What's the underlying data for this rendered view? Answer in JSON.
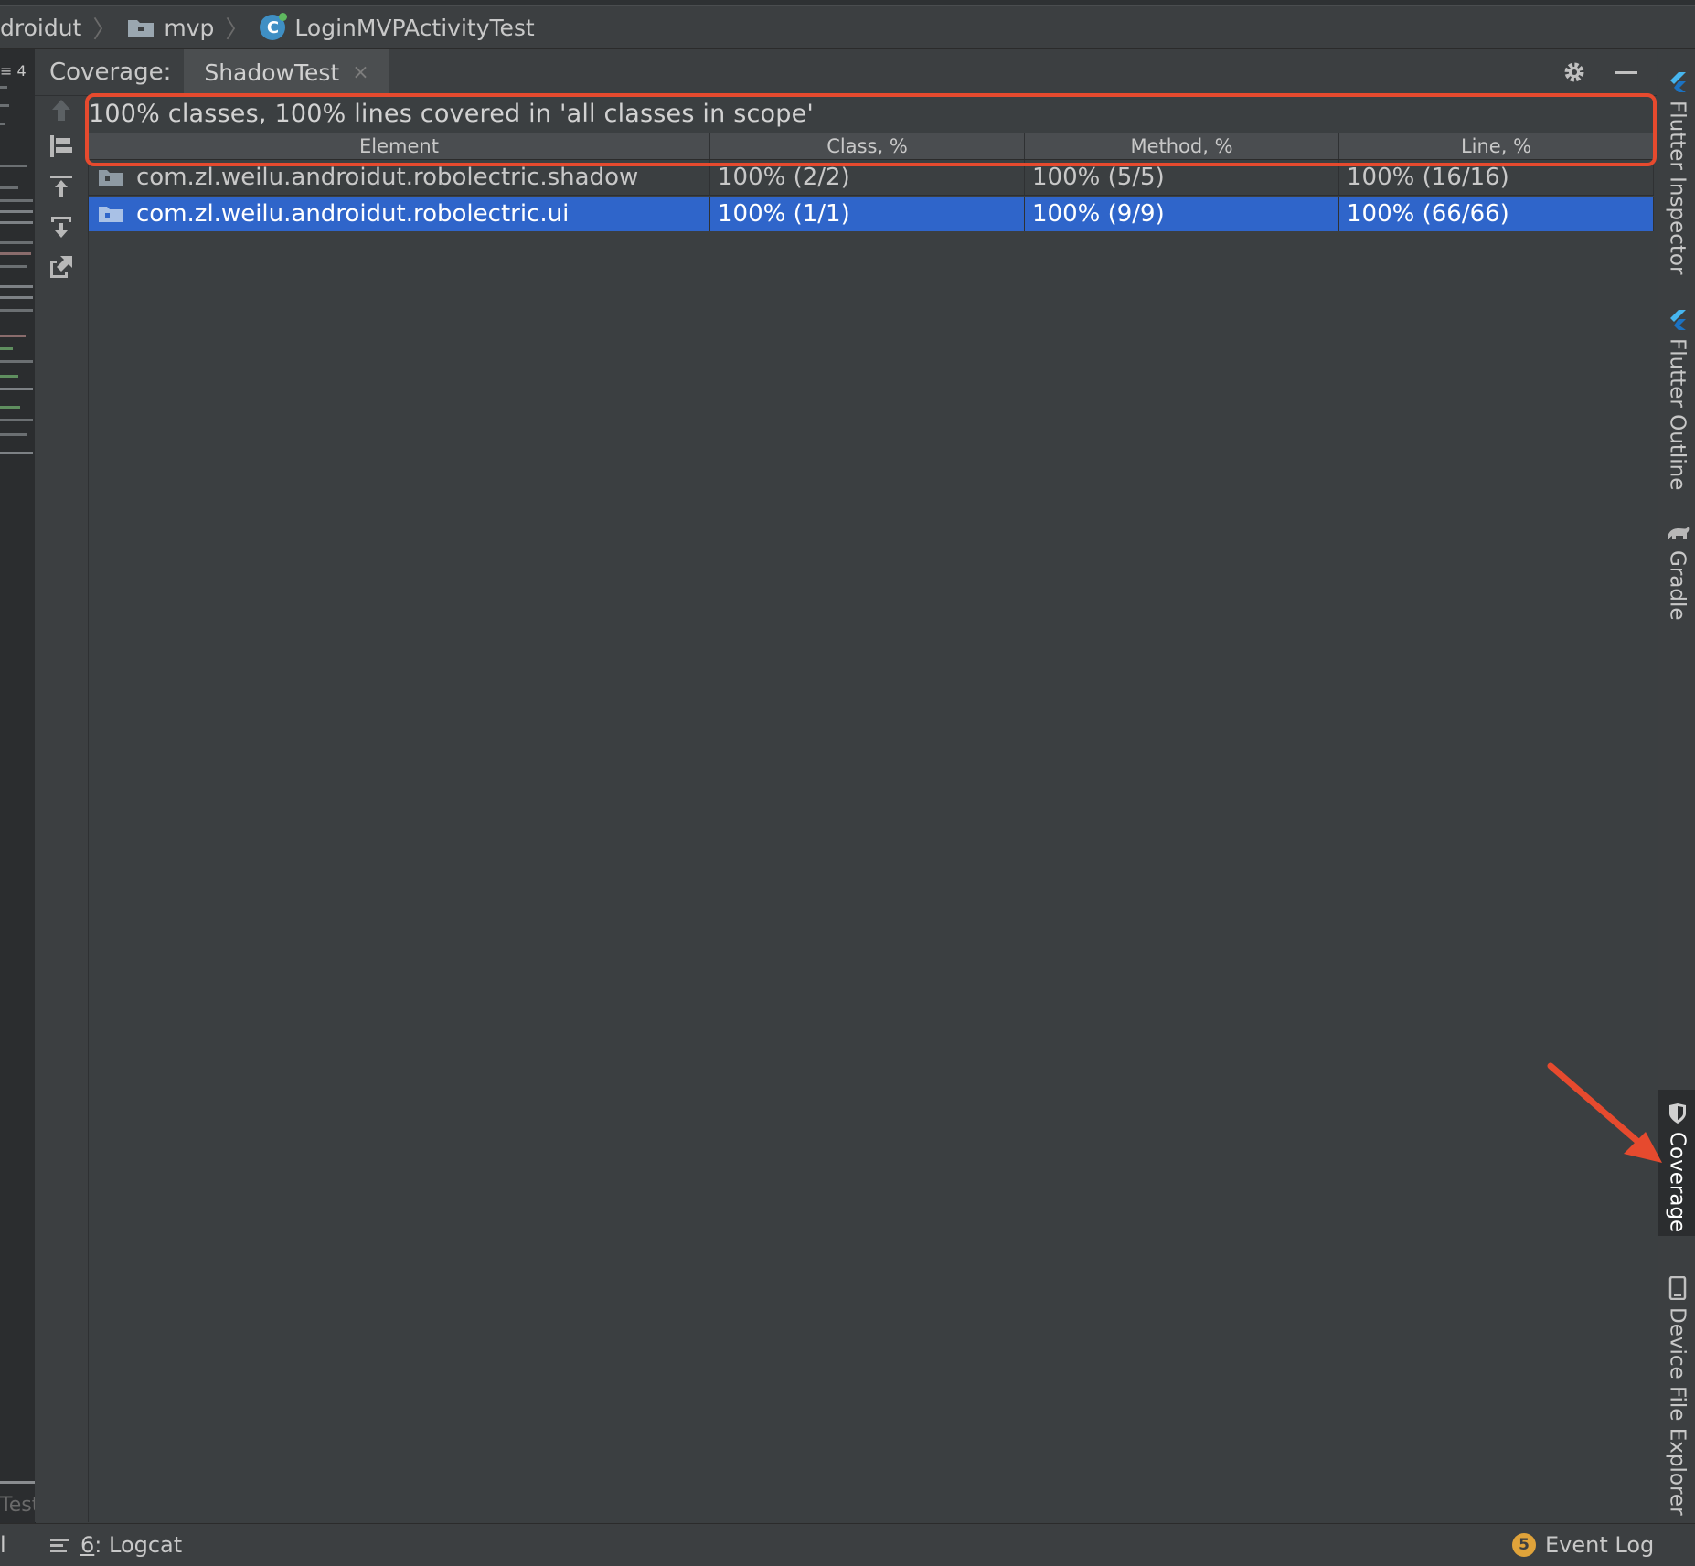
{
  "breadcrumb": {
    "items": [
      "droidut",
      "mvp",
      "LoginMVPActivityTest"
    ],
    "class_icon_letter": "C"
  },
  "left_strip": {
    "header": "4",
    "bottom_text": "Test"
  },
  "panel": {
    "title": "Coverage:",
    "tab_label": "ShadowTest",
    "tab_close": "×"
  },
  "coverage": {
    "summary": "100% classes, 100% lines covered in 'all classes in scope'",
    "columns": [
      "Element",
      "Class, %",
      "Method, %",
      "Line, %"
    ],
    "rows": [
      {
        "element": "com.zl.weilu.androidut.robolectric.shadow",
        "class": "100% (2/2)",
        "method": "100% (5/5)",
        "line": "100% (16/16)"
      },
      {
        "element": "com.zl.weilu.androidut.robolectric.ui",
        "class": "100% (1/1)",
        "method": "100% (9/9)",
        "line": "100% (66/66)"
      }
    ]
  },
  "right_tools": [
    "Flutter Inspector",
    "Flutter Outline",
    "Gradle",
    "Coverage",
    "Device File Explorer"
  ],
  "bottom": {
    "logcat_num": "6",
    "logcat_label": ": Logcat",
    "event_badge": "5",
    "event_label": "Event Log",
    "left_char": "l"
  },
  "colors": {
    "selection": "#2f65ca",
    "highlight": "#e64a2e",
    "background": "#3b3f41"
  }
}
